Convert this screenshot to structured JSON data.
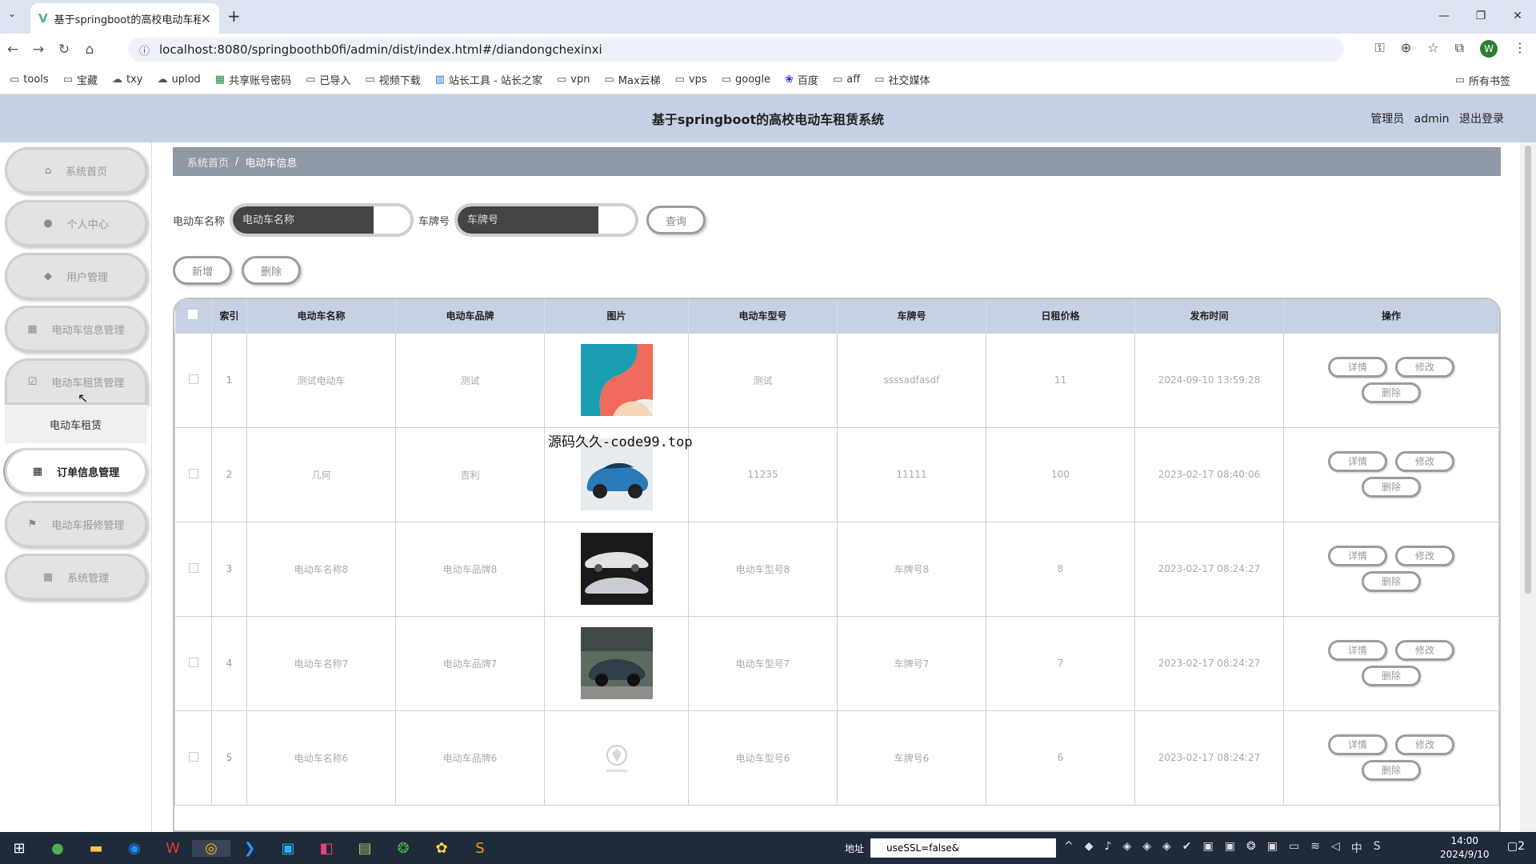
{
  "browser": {
    "tab_title": "基于springboot的高校电动车租赁",
    "url": "localhost:8080/springboothb0fi/admin/dist/index.html#/diandongchexinxi",
    "profile_initial": "W",
    "bookmarks": [
      "tools",
      "宝藏",
      "txy",
      "uplod",
      "共享账号密码",
      "已导入",
      "视频下载",
      "站长工具 - 站长之家",
      "vpn",
      "Max云梯",
      "vps",
      "google",
      "百度",
      "aff",
      "社交媒体"
    ],
    "all_bookmarks": "所有书签"
  },
  "header": {
    "title": "基于springboot的高校电动车租赁系统",
    "role": "管理员",
    "user": "admin",
    "logout": "退出登录"
  },
  "sidebar": {
    "items": [
      {
        "label": "系统首页",
        "icon": "home-icon"
      },
      {
        "label": "个人中心",
        "icon": "user-icon"
      },
      {
        "label": "用户管理",
        "icon": "pin-icon"
      },
      {
        "label": "电动车信息管理",
        "icon": "grid-icon"
      },
      {
        "label": "电动车租赁管理",
        "icon": "check-icon"
      },
      {
        "label": "订单信息管理",
        "icon": "grid-icon"
      },
      {
        "label": "电动车报修管理",
        "icon": "flag-icon"
      },
      {
        "label": "系统管理",
        "icon": "grid-icon"
      }
    ],
    "submenu_label": "电动车租赁"
  },
  "breadcrumb": {
    "home": "系统首页",
    "current": "电动车信息"
  },
  "search": {
    "name_label": "电动车名称",
    "name_placeholder": "电动车名称",
    "plate_label": "车牌号",
    "plate_placeholder": "车牌号",
    "query": "查询"
  },
  "actions": {
    "add": "新增",
    "delete": "删除"
  },
  "table": {
    "headers": [
      "索引",
      "电动车名称",
      "电动车品牌",
      "图片",
      "电动车型号",
      "车牌号",
      "日租价格",
      "发布时间",
      "操作"
    ],
    "ops": {
      "detail": "详情",
      "edit": "修改",
      "delete": "删除"
    },
    "rows": [
      {
        "index": "1",
        "name": "测试电动车",
        "brand": "测试",
        "model": "测试",
        "plate": "ssssadfasdf",
        "price": "11",
        "time": "2024-09-10 13:59:28"
      },
      {
        "index": "2",
        "name": "几何",
        "brand": "吉利",
        "model": "11235",
        "plate": "11111",
        "price": "100",
        "time": "2023-02-17 08:40:06"
      },
      {
        "index": "3",
        "name": "电动车名称8",
        "brand": "电动车品牌8",
        "model": "电动车型号8",
        "plate": "车牌号8",
        "price": "8",
        "time": "2023-02-17 08:24:27"
      },
      {
        "index": "4",
        "name": "电动车名称7",
        "brand": "电动车品牌7",
        "model": "电动车型号7",
        "plate": "车牌号7",
        "price": "7",
        "time": "2023-02-17 08:24:27"
      },
      {
        "index": "5",
        "name": "电动车名称6",
        "brand": "电动车品牌6",
        "model": "电动车型号6",
        "plate": "车牌号6",
        "price": "6",
        "time": "2023-02-17 08:24:27"
      }
    ]
  },
  "watermark": "源码久久-code99.top",
  "taskbar": {
    "addr_label": "地址",
    "addr_value": "useSSL=false&",
    "time": "14:00",
    "date": "2024/9/10",
    "ime": "中",
    "notif": "2"
  }
}
